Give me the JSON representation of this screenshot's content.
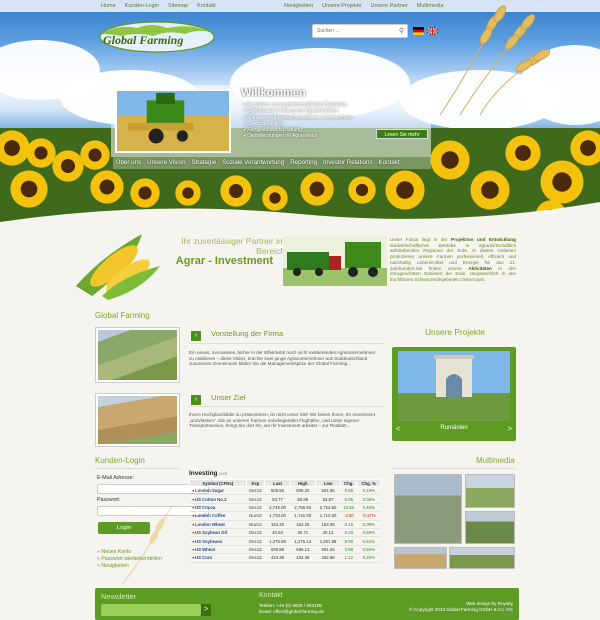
{
  "top_nav_left": [
    "Home",
    "Kunden-Login",
    "Sitemap",
    "Kontakt"
  ],
  "top_nav_right": [
    "Neuigkeiten",
    "Unsere Projekte",
    "Unsere Partner",
    "Multimedia"
  ],
  "logo_text": "Global Farming",
  "search": {
    "placeholder": "Suchen ..."
  },
  "welcome": {
    "title": "Willkommen",
    "items": [
      "Projektion von landwirtschaftlichen Betrieben",
      "Eigenbewirtschaftung von Agrarbetrieben",
      "Management landwirtschaftlicher Unternehmen",
      "Landcontracting",
      "Komplettbewirtschaftung",
      "Dienstleistungen im Agrarsektor"
    ],
    "more_label": "Lesen Sie mehr"
  },
  "main_nav": [
    "Über uns",
    "Unsere Vision",
    "Strategie",
    "Soziale Verantwortung",
    "Reporting",
    "Investor Relations",
    "Kontakt"
  ],
  "agrar": {
    "tagline": "Ihr zuverlässiger Partner im Bereich",
    "title": "Agrar - Investment",
    "focus_1": "Unser Fokus liegt in der ",
    "focus_b1": "Projektion und Entwicklung",
    "focus_2": " landwirtschaftlicher Betriebe in agrarwirtschaftlich aufstrebenden Regionen der Erde. In diesen Gebieten produzieren unsere Farmen professionell, effizient und nachhaltig Lebensmittel und Energie für das 21. Jahrhundert.Sie finden unsere ",
    "focus_b2": "Aktivitäten",
    "focus_3": " in den ertragreichsten Gebieten der Erde. Hauptsächlich in den fruchtbaren Schwarzerdegebieten Osteuropas."
  },
  "global_farming": {
    "title": "Global Farming",
    "s1_title": "Vorstellung der Firma",
    "s1_text": "Ein neues, innovatives, bisher in der Effektivität noch nicht existierendes Agrarunternehmen zu etablieren – diese Vision, brachte zwei junge Agrarunternehmer aus Süddeutschland zusammen.Gemeinsam bilden Sie die Managementspitze der Global Farming...",
    "s2_title": "Unser Ziel",
    "s2_text": "Ihnen Hochglanzbilder zu präsentieren, ist nicht unser Ziel! Wir bieten Ihnen, Ihr Investment „anzufassen\". Die an unseren Farmen naheliegenden Flughäfen, und unser eigener Transportservice, bringt Sie dort hin, wo Ihr Investment arbeitet – zur Realität!..."
  },
  "projects": {
    "title": "Unsere Projekte",
    "caption": "Rumänien",
    "prev": "<",
    "next": ">"
  },
  "login": {
    "title": "Kunden-Login",
    "email_label": "E-Mail Adresse:",
    "password_label": "Passwort:",
    "button": "Login",
    "links": [
      "» Neues Konto",
      "» Passwort wiederherstellen",
      "» Neuigkeiten"
    ]
  },
  "investing": {
    "logo": "Investing",
    "logo_suffix": ".com",
    "headers": [
      "Symbol (CFDs)",
      "Exp",
      "Last",
      "High",
      "Low",
      "Chg.",
      "Chg. %"
    ],
    "rows": [
      [
        "London Sugar",
        "Dec13",
        "506.50",
        "506.20",
        "504.65",
        "0.55",
        "0.19%"
      ],
      [
        "US Cotton No.2",
        "Dec13",
        "83.77",
        "83.85",
        "83.57",
        "0.05",
        "0.06%"
      ],
      [
        "US Cocoa",
        "Dec13",
        "2,745.00",
        "2,756.50",
        "2,722.50",
        "12.50",
        "0.46%"
      ],
      [
        "London Coffee",
        "Nov13",
        "1,733.00",
        "1,741.00",
        "1,712.00",
        "-3.00",
        "-0.17%"
      ],
      [
        "London Wheat",
        "Nov13",
        "163.25",
        "163.25",
        "163.05",
        "0.15",
        "0.09%"
      ],
      [
        "US Soybean Oil",
        "Dec13",
        "40.63",
        "40.71",
        "40.13",
        "0.28",
        "0.68%"
      ],
      [
        "US Soybeans",
        "Dec13",
        "1,275.88",
        "1,276.13",
        "1,261.88",
        "8.00",
        "0.63%"
      ],
      [
        "US Wheat",
        "Dec13",
        "695.88",
        "696.13",
        "691.63",
        "3.88",
        "0.56%"
      ],
      [
        "US Corn",
        "Dec13",
        "434.38",
        "434.38",
        "432.88",
        "1.12",
        "0.26%"
      ]
    ],
    "note_link": "Commodities",
    "note_text": " are powered by Investing.com."
  },
  "multimedia": {
    "title": "Multimedia"
  },
  "footer": {
    "newsletter": "Newsletter",
    "nl_btn": ">",
    "kontakt": "Kontakt",
    "telefon": "Telefon: +49 (0) 9936 / 903198",
    "email": "Email: office@global-farming.de",
    "design": "Web design by Royalty",
    "copyright": "© Copyright 2013 Global Farming GmbH & Co. KG"
  },
  "colors": {
    "accent": "#5d9c23",
    "dark_green": "#3f7d14",
    "text_green": "#6a9a25"
  }
}
